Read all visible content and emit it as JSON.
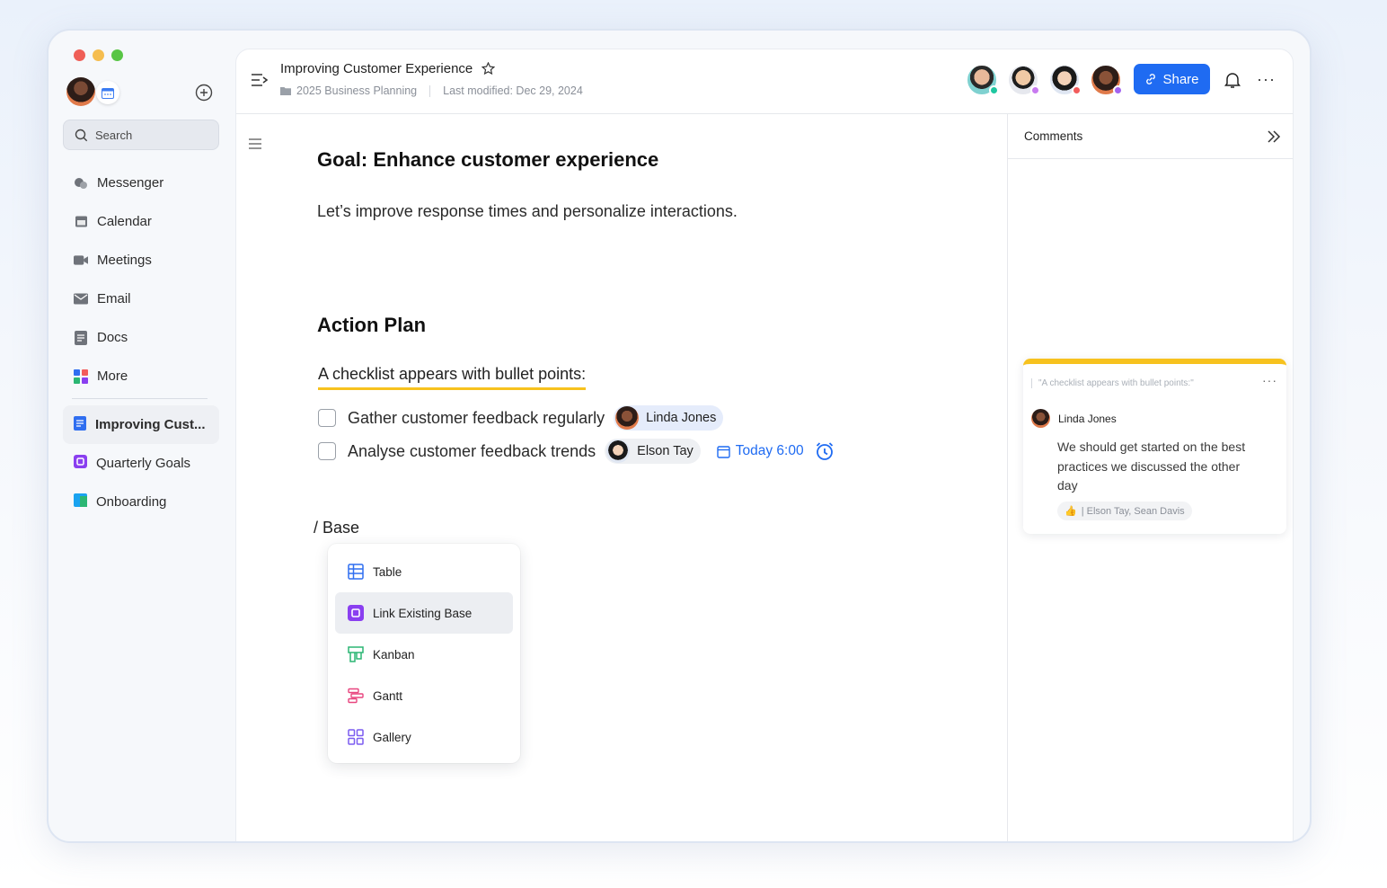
{
  "sidebar": {
    "search_placeholder": "Search",
    "nav": [
      {
        "label": "Messenger",
        "icon": "chat-icon"
      },
      {
        "label": "Calendar",
        "icon": "calendar-icon"
      },
      {
        "label": "Meetings",
        "icon": "video-icon"
      },
      {
        "label": "Email",
        "icon": "mail-icon"
      },
      {
        "label": "Docs",
        "icon": "doc-icon"
      },
      {
        "label": "More",
        "icon": "grid-icon"
      }
    ],
    "docs": [
      {
        "label": "Improving Cust...",
        "color": "#2f6ef0",
        "active": true
      },
      {
        "label": "Quarterly Goals",
        "color": "#8a3ff0",
        "active": false
      },
      {
        "label": "Onboarding",
        "color": "#1aa3f0",
        "active": false
      }
    ]
  },
  "header": {
    "title": "Improving Customer Experience",
    "folder": "2025 Business Planning",
    "modified": "Last modified: Dec 29, 2024",
    "share_label": "Share",
    "collaborator_status_colors": [
      "#1fc7a0",
      "#c87af0",
      "#f25c5c",
      "#a263f0"
    ]
  },
  "editor": {
    "goal_heading": "Goal: Enhance customer experience",
    "intro": "Let’s improve response times and personalize interactions.",
    "plan_heading": "Action Plan",
    "checklist_title": "A checklist appears with bullet points:",
    "tasks": [
      {
        "text": "Gather customer feedback regularly",
        "assignee": "Linda Jones"
      },
      {
        "text": "Analyse customer feedback trends",
        "assignee": "Elson Tay",
        "due": "Today 6:00"
      }
    ],
    "slash_command": "/ Base",
    "menu": [
      {
        "label": "Table",
        "icon": "table-icon",
        "color": "#2f6ef0"
      },
      {
        "label": "Link Existing Base",
        "icon": "link-base-icon",
        "color": "#8a3ff0"
      },
      {
        "label": "Kanban",
        "icon": "kanban-icon",
        "color": "#2bb673"
      },
      {
        "label": "Gantt",
        "icon": "gantt-icon",
        "color": "#e8457f"
      },
      {
        "label": "Gallery",
        "icon": "gallery-icon",
        "color": "#7b5cf0"
      }
    ]
  },
  "comments": {
    "title": "Comments",
    "quote": "\"A checklist appears with bullet points:\"",
    "author": "Linda Jones",
    "text": "We should get started on the best practices we discussed the other day",
    "reactors": "| Elson Tay, Sean Davis",
    "accent": "#f7c21e"
  }
}
